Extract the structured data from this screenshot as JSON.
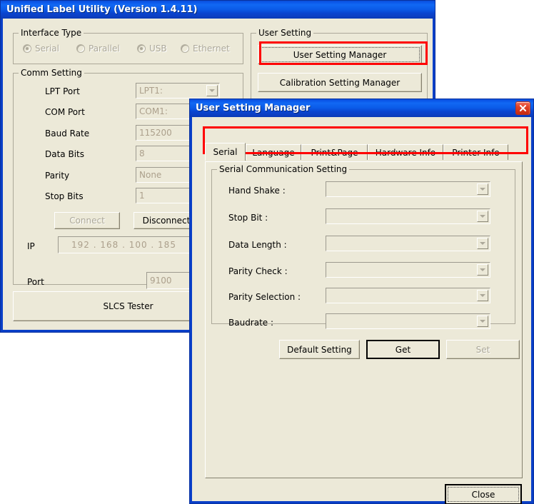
{
  "main_window": {
    "title": "Unified Label Utility  (Version 1.4.11)",
    "interface_type": {
      "legend": "Interface Type",
      "options": [
        {
          "label": "Serial",
          "selected": false
        },
        {
          "label": "Parallel",
          "selected": false
        },
        {
          "label": "USB",
          "selected": true
        },
        {
          "label": "Ethernet",
          "selected": false
        }
      ]
    },
    "comm_setting": {
      "legend": "Comm Setting",
      "rows": [
        {
          "label": "LPT Port",
          "value": "LPT1:",
          "type": "combo"
        },
        {
          "label": "COM Port",
          "value": "COM1:",
          "type": "combo"
        },
        {
          "label": "Baud Rate",
          "value": "115200",
          "type": "combo"
        },
        {
          "label": "Data Bits",
          "value": "8",
          "type": "combo"
        },
        {
          "label": "Parity",
          "value": "None",
          "type": "combo"
        },
        {
          "label": "Stop Bits",
          "value": "1",
          "type": "combo"
        }
      ],
      "connect_label": "Connect",
      "disconnect_label": "Disconnect",
      "ip_label": "IP",
      "ip_value": "192  .  168  .  100  .  185",
      "port_label": "Port",
      "port_value": "9100"
    },
    "slcs_tester_label": "SLCS Tester",
    "user_setting": {
      "legend": "User Setting",
      "user_setting_manager_label": "User Setting Manager",
      "calibration_setting_manager_label": "Calibration Setting Manager"
    }
  },
  "dialog": {
    "title": "User Setting Manager",
    "close_icon": "close-icon",
    "tabs": [
      {
        "label": "Serial",
        "active": true
      },
      {
        "label": "Language",
        "active": false
      },
      {
        "label": "Print&Page",
        "active": false
      },
      {
        "label": "Hardware Info",
        "active": false
      },
      {
        "label": "Printer Info",
        "active": false
      }
    ],
    "serial_group": {
      "legend": "Serial Communication Setting",
      "rows": [
        {
          "label": "Hand Shake :",
          "value": ""
        },
        {
          "label": "Stop Bit :",
          "value": ""
        },
        {
          "label": "Data Length :",
          "value": ""
        },
        {
          "label": "Parity Check :",
          "value": ""
        },
        {
          "label": "Parity Selection :",
          "value": ""
        },
        {
          "label": "Baudrate :",
          "value": ""
        }
      ]
    },
    "actions": {
      "default_setting_label": "Default Setting",
      "get_label": "Get",
      "set_label": "Set"
    },
    "close_label": "Close"
  },
  "colors": {
    "highlight": "#ff0000",
    "titlebar_blue": "#0a4fd8",
    "face": "#ece9d8"
  }
}
